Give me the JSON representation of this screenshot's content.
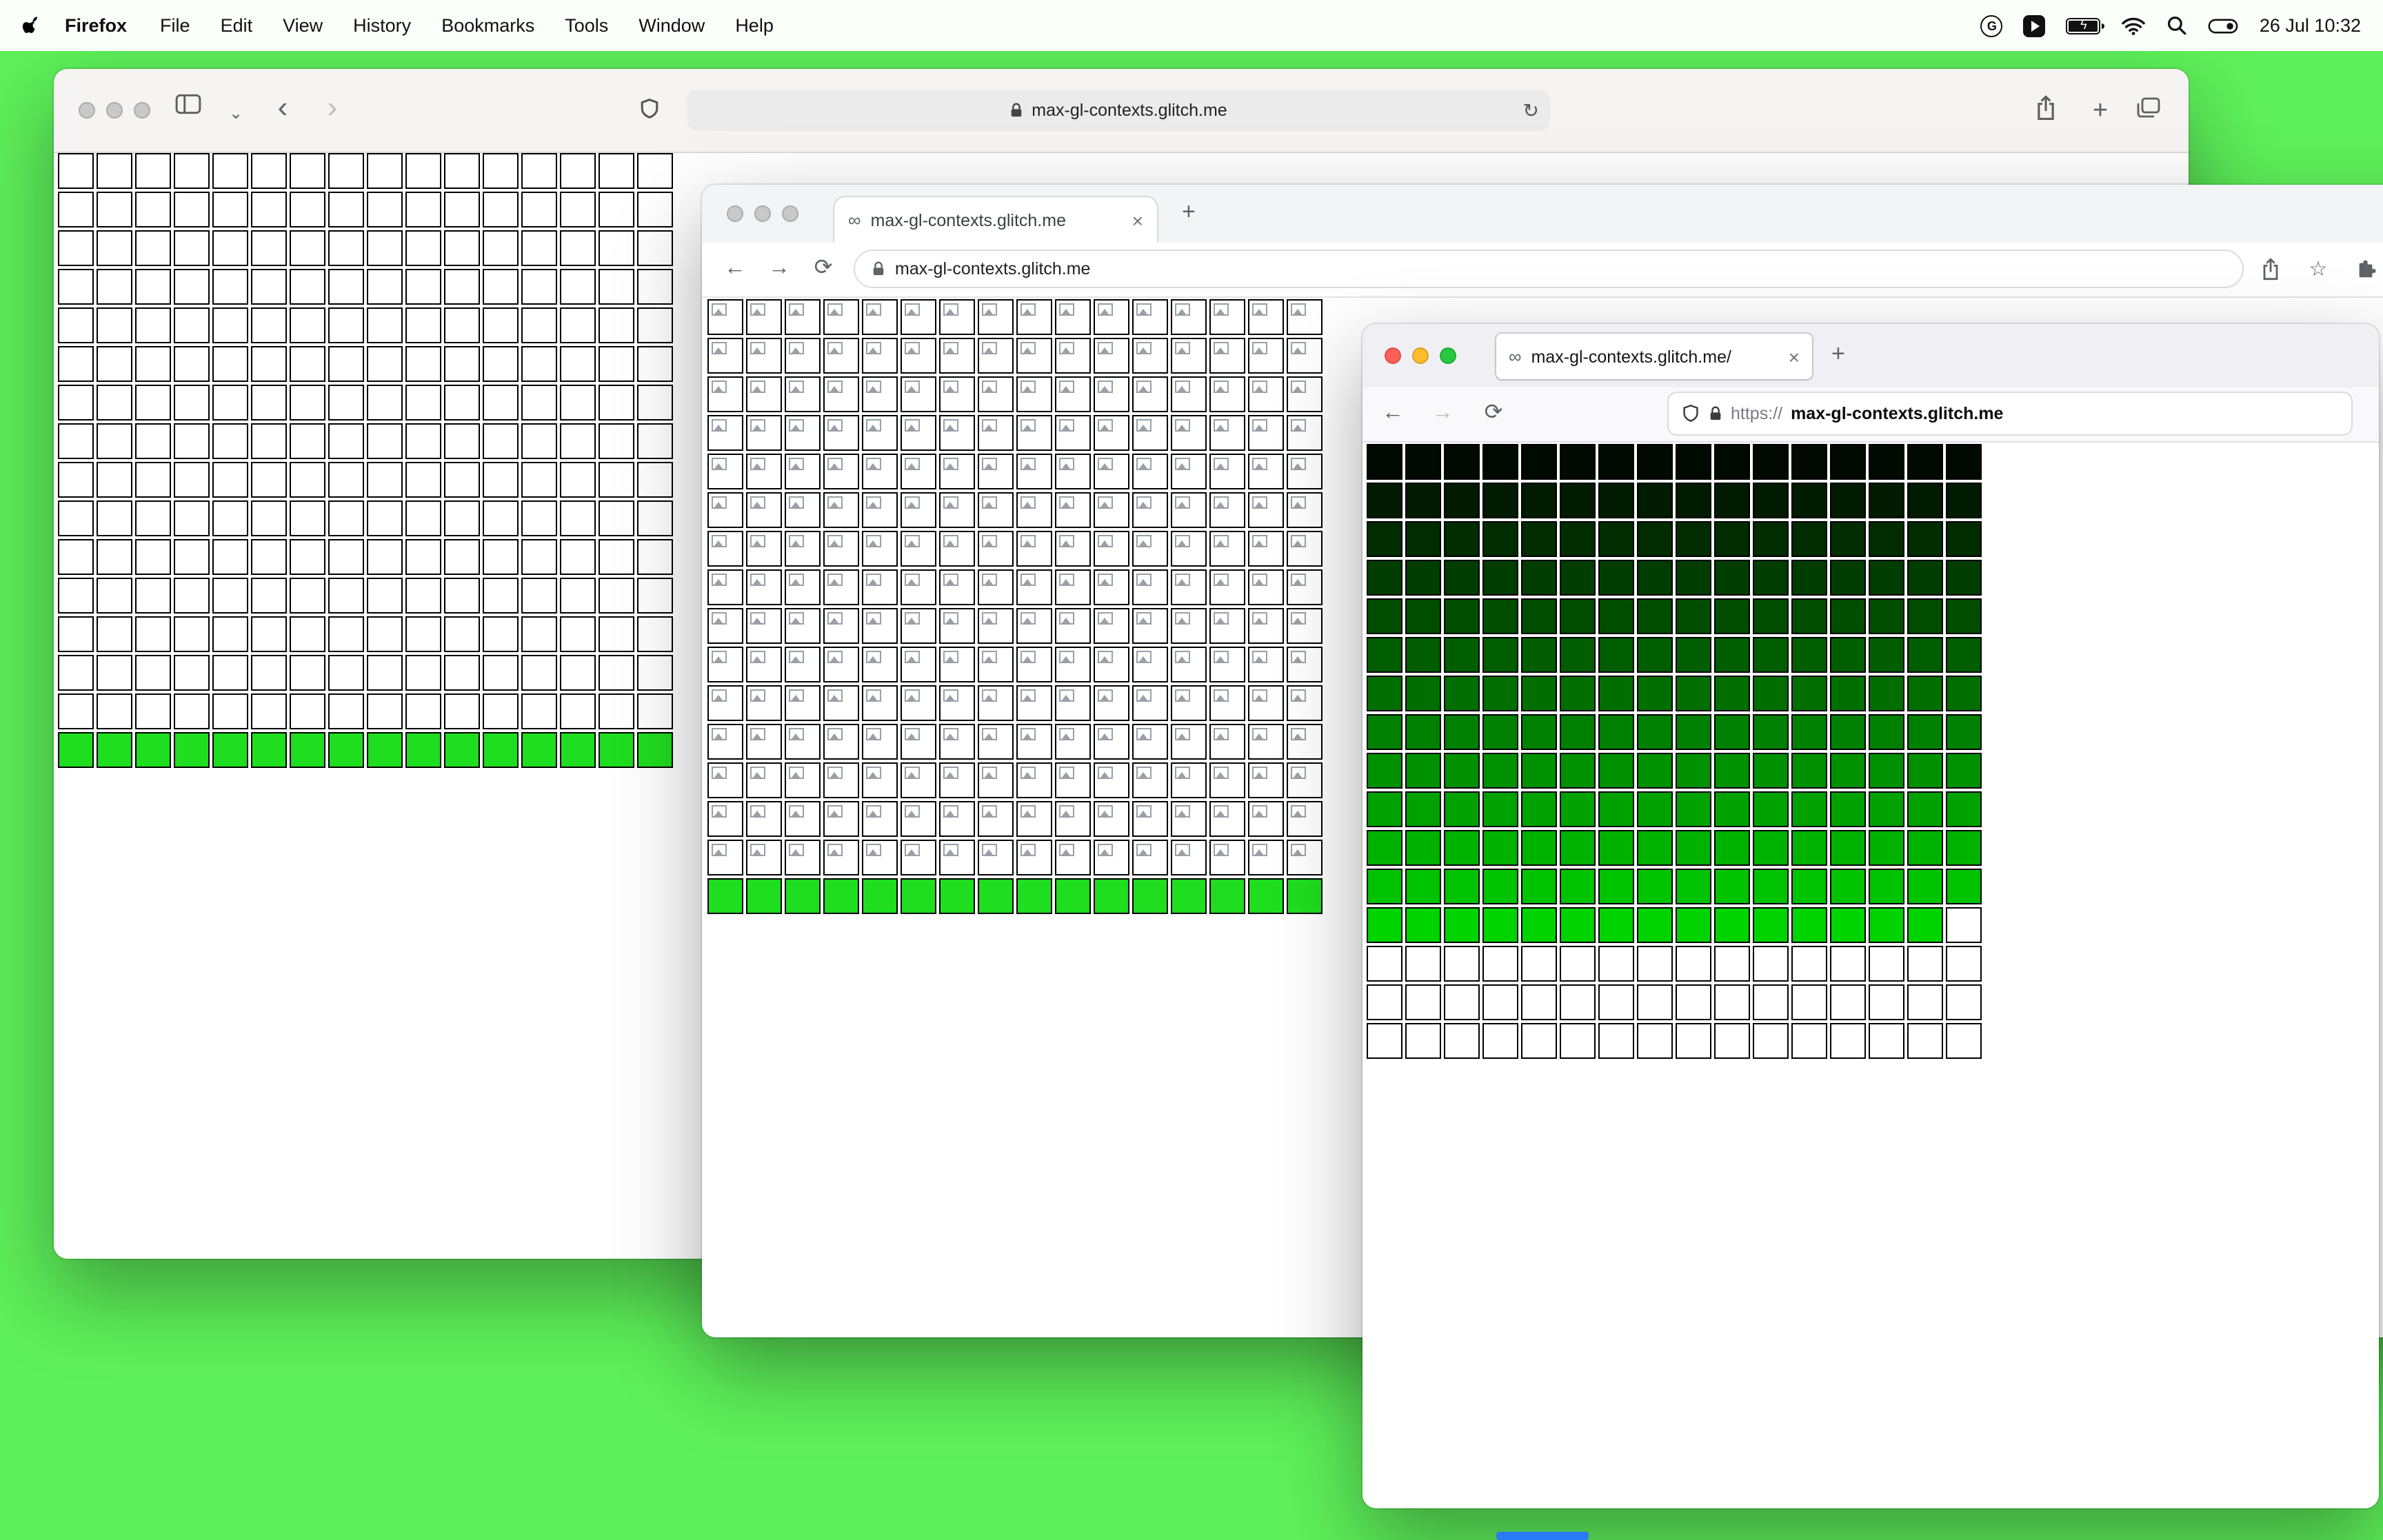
{
  "menu_bar": {
    "app_name": "Firefox",
    "menus": [
      "File",
      "Edit",
      "View",
      "History",
      "Bookmarks",
      "Tools",
      "Window",
      "Help"
    ],
    "clock": "26 Jul 10:32",
    "grammarly_letter": "G"
  },
  "colors": {
    "desktop_bg": "#5ef05a",
    "bright_green": "#1fdd1f",
    "dock_blue": "#2a7bf6"
  },
  "safari_window": {
    "url": "max-gl-contexts.glitch.me",
    "reload_glyph": "↻",
    "grid": {
      "cols": 16,
      "white_rows": 15,
      "green_rows": 1
    }
  },
  "chrome_window": {
    "tab_title": "max-gl-contexts.glitch.me",
    "url": "max-gl-contexts.glitch.me",
    "tab_favicon": "∞",
    "close_glyph": "×",
    "new_tab_glyph": "+",
    "back_glyph": "←",
    "forward_glyph": "→",
    "reload_glyph": "⟳",
    "star_glyph": "☆",
    "grid": {
      "cols": 16,
      "broken_rows": 15,
      "green_rows": 1
    }
  },
  "firefox_window": {
    "tab_title": "max-gl-contexts.glitch.me/",
    "url_scheme": "https://",
    "url_domain": "max-gl-contexts.glitch.me",
    "tab_favicon": "∞",
    "close_glyph": "×",
    "new_tab_glyph": "+",
    "back_glyph": "←",
    "forward_glyph": "→",
    "reload_glyph": "⟳",
    "grid": {
      "cols": 16,
      "gradient_rows": 13,
      "white_rows": 3,
      "gradient_start_g": 10,
      "gradient_end_g": 212,
      "last_gradient_row_last_cell_white": true
    }
  },
  "safari_nav": {
    "back_glyph": "‹",
    "forward_glyph": "›",
    "chevron_glyph": "⌄",
    "plus_glyph": "+"
  }
}
